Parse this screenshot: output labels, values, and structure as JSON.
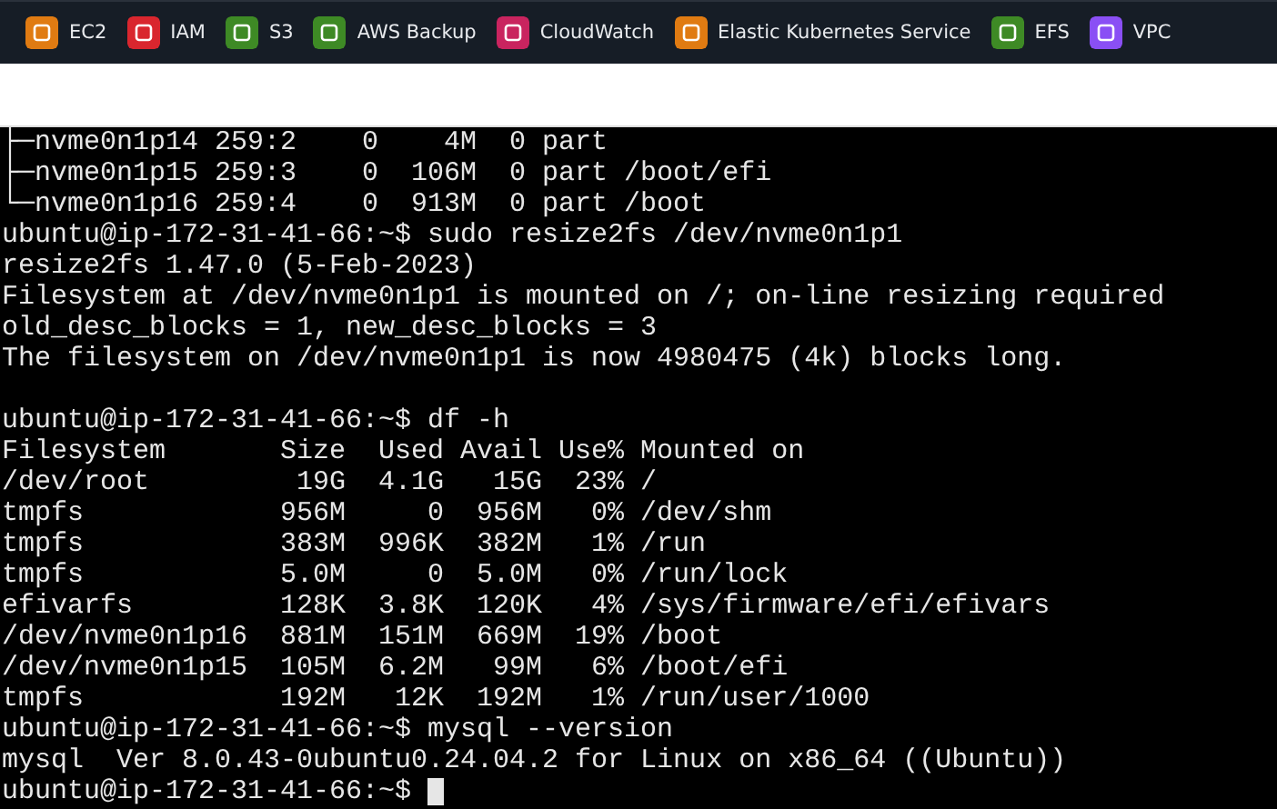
{
  "service_bar": {
    "items": [
      {
        "label": "EC2",
        "color": "#e07b12"
      },
      {
        "label": "IAM",
        "color": "#d9262e"
      },
      {
        "label": "S3",
        "color": "#3e8a25"
      },
      {
        "label": "AWS Backup",
        "color": "#3e8a25"
      },
      {
        "label": "CloudWatch",
        "color": "#c9245f"
      },
      {
        "label": "Elastic Kubernetes Service",
        "color": "#e07b12"
      },
      {
        "label": "EFS",
        "color": "#3e8a25"
      },
      {
        "label": "VPC",
        "color": "#8a4ff5"
      }
    ]
  },
  "terminal": {
    "blocks": [
      {
        "lines": [
          "├─nvme0n1p14 259:2    0    4M  0 part",
          "├─nvme0n1p15 259:3    0  106M  0 part /boot/efi",
          "└─nvme0n1p16 259:4    0  913M  0 part /boot",
          "ubuntu@ip-172-31-41-66:~$ sudo resize2fs /dev/nvme0n1p1",
          "resize2fs 1.47.0 (5-Feb-2023)",
          "Filesystem at /dev/nvme0n1p1 is mounted on /; on-line resizing required",
          "old_desc_blocks = 1, new_desc_blocks = 3",
          "The filesystem on /dev/nvme0n1p1 is now 4980475 (4k) blocks long."
        ]
      },
      {
        "lines": [
          "ubuntu@ip-172-31-41-66:~$ df -h",
          "Filesystem       Size  Used Avail Use% Mounted on",
          "/dev/root         19G  4.1G   15G  23% /",
          "tmpfs            956M     0  956M   0% /dev/shm",
          "tmpfs            383M  996K  382M   1% /run",
          "tmpfs            5.0M     0  5.0M   0% /run/lock",
          "efivarfs         128K  3.8K  120K   4% /sys/firmware/efi/efivars",
          "/dev/nvme0n1p16  881M  151M  669M  19% /boot",
          "/dev/nvme0n1p15  105M  6.2M   99M   6% /boot/efi",
          "tmpfs            192M   12K  192M   1% /run/user/1000",
          "ubuntu@ip-172-31-41-66:~$ mysql --version",
          "mysql  Ver 8.0.43-0ubuntu0.24.04.2 for Linux on x86_64 ((Ubuntu))"
        ]
      }
    ],
    "prompt": "ubuntu@ip-172-31-41-66:~$"
  }
}
